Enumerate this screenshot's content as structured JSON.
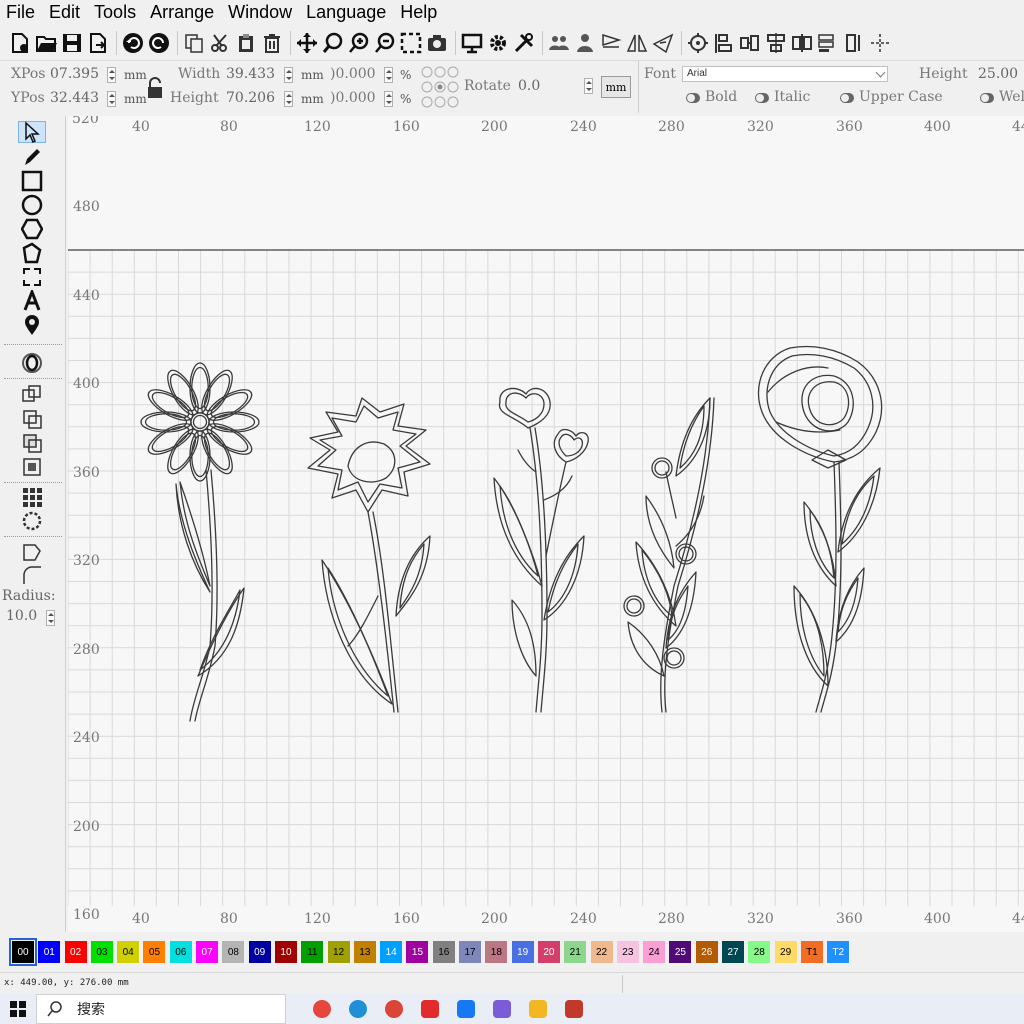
{
  "menu": [
    {
      "label": "File"
    },
    {
      "label": "Edit"
    },
    {
      "label": "Tools"
    },
    {
      "label": "Arrange"
    },
    {
      "label": "Window"
    },
    {
      "label": "Language"
    },
    {
      "label": "Help"
    }
  ],
  "props": {
    "xpos_label": "XPos",
    "xpos_value": "07.395",
    "ypos_label": "YPos",
    "ypos_value": "32.443",
    "unit_mm": "mm",
    "width_label": "Width",
    "width_value": "39.433",
    "height_label": "Height",
    "height_value": "70.206",
    "scale_x": ")0.000",
    "scale_y": ")0.000",
    "percent": "%",
    "rotate_label": "Rotate",
    "rotate_value": "0.0",
    "mm_button": "mm",
    "font_label": "Font",
    "font_value": "Arial",
    "text_height_label": "Height",
    "text_height_value": "25.00",
    "bold_label": "Bold",
    "italic_label": "Italic",
    "upper_case_label": "Upper Case",
    "weld_label": "Wel"
  },
  "leftbar": {
    "radius_label": "Radius:",
    "radius_value": "10.0"
  },
  "ruler": {
    "top_ticks": [
      "40",
      "80",
      "120",
      "160",
      "200",
      "240",
      "280",
      "320",
      "360",
      "400",
      "44"
    ],
    "bottom_ticks": [
      "40",
      "80",
      "120",
      "160",
      "200",
      "240",
      "280",
      "320",
      "360",
      "400",
      "44"
    ],
    "left_ticks": [
      "520",
      "480",
      "440",
      "400",
      "360",
      "320",
      "280",
      "240",
      "200",
      "160"
    ]
  },
  "palette": [
    {
      "label": "00",
      "color": "#000000",
      "text": "#ffffff"
    },
    {
      "label": "01",
      "color": "#0000ff",
      "text": "#ffffff"
    },
    {
      "label": "02",
      "color": "#ff0000",
      "text": "#ffffff"
    },
    {
      "label": "03",
      "color": "#00e000",
      "text": "#000000"
    },
    {
      "label": "04",
      "color": "#d0d000",
      "text": "#000000"
    },
    {
      "label": "05",
      "color": "#ff8000",
      "text": "#000000"
    },
    {
      "label": "06",
      "color": "#00e0e0",
      "text": "#000000"
    },
    {
      "label": "07",
      "color": "#ff00ff",
      "text": "#ffffff"
    },
    {
      "label": "08",
      "color": "#b4b4b4",
      "text": "#000000"
    },
    {
      "label": "09",
      "color": "#0000a0",
      "text": "#ffffff"
    },
    {
      "label": "10",
      "color": "#a00000",
      "text": "#ffffff"
    },
    {
      "label": "11",
      "color": "#00a000",
      "text": "#000000"
    },
    {
      "label": "12",
      "color": "#a0a000",
      "text": "#000000"
    },
    {
      "label": "13",
      "color": "#c08000",
      "text": "#000000"
    },
    {
      "label": "14",
      "color": "#00a0ff",
      "text": "#ffffff"
    },
    {
      "label": "15",
      "color": "#a000a0",
      "text": "#ffffff"
    },
    {
      "label": "16",
      "color": "#808080",
      "text": "#000000"
    },
    {
      "label": "17",
      "color": "#7d87b9",
      "text": "#000000"
    },
    {
      "label": "18",
      "color": "#bb7784",
      "text": "#000000"
    },
    {
      "label": "19",
      "color": "#4a6fe3",
      "text": "#ffffff"
    },
    {
      "label": "20",
      "color": "#d33f6a",
      "text": "#ffffff"
    },
    {
      "label": "21",
      "color": "#8cd78c",
      "text": "#000000"
    },
    {
      "label": "22",
      "color": "#f0b98d",
      "text": "#000000"
    },
    {
      "label": "23",
      "color": "#f6c4e1",
      "text": "#000000"
    },
    {
      "label": "24",
      "color": "#fa9ed4",
      "text": "#000000"
    },
    {
      "label": "25",
      "color": "#500a78",
      "text": "#ffffff"
    },
    {
      "label": "26",
      "color": "#b45a00",
      "text": "#ffffff"
    },
    {
      "label": "27",
      "color": "#004754",
      "text": "#ffffff"
    },
    {
      "label": "28",
      "color": "#86fa88",
      "text": "#000000"
    },
    {
      "label": "29",
      "color": "#ffdb66",
      "text": "#000000"
    },
    {
      "label": "T1",
      "color": "#f36c23",
      "text": "#000000"
    },
    {
      "label": "T2",
      "color": "#1e90ff",
      "text": "#ffffff"
    }
  ],
  "status": {
    "coords": "x: 449.00, y: 276.00 mm"
  },
  "taskbar": {
    "search_placeholder": "搜索",
    "apps": [
      {
        "name": "chrome-icon",
        "color": "#e8453c"
      },
      {
        "name": "edge-icon",
        "color": "#1f8fd6"
      },
      {
        "name": "chrome-alt-icon",
        "color": "#db4437"
      },
      {
        "name": "wps-icon",
        "color": "#e32b2b"
      },
      {
        "name": "media-icon",
        "color": "#1778f2"
      },
      {
        "name": "photos-icon",
        "color": "#7b5cd6"
      },
      {
        "name": "file-explorer-icon",
        "color": "#f2b722"
      },
      {
        "name": "laser-app-icon",
        "color": "#c0392b"
      }
    ]
  },
  "colors": {
    "grid": "#d8d8d8",
    "outline": "#333333",
    "selection": "#2a62d6"
  }
}
